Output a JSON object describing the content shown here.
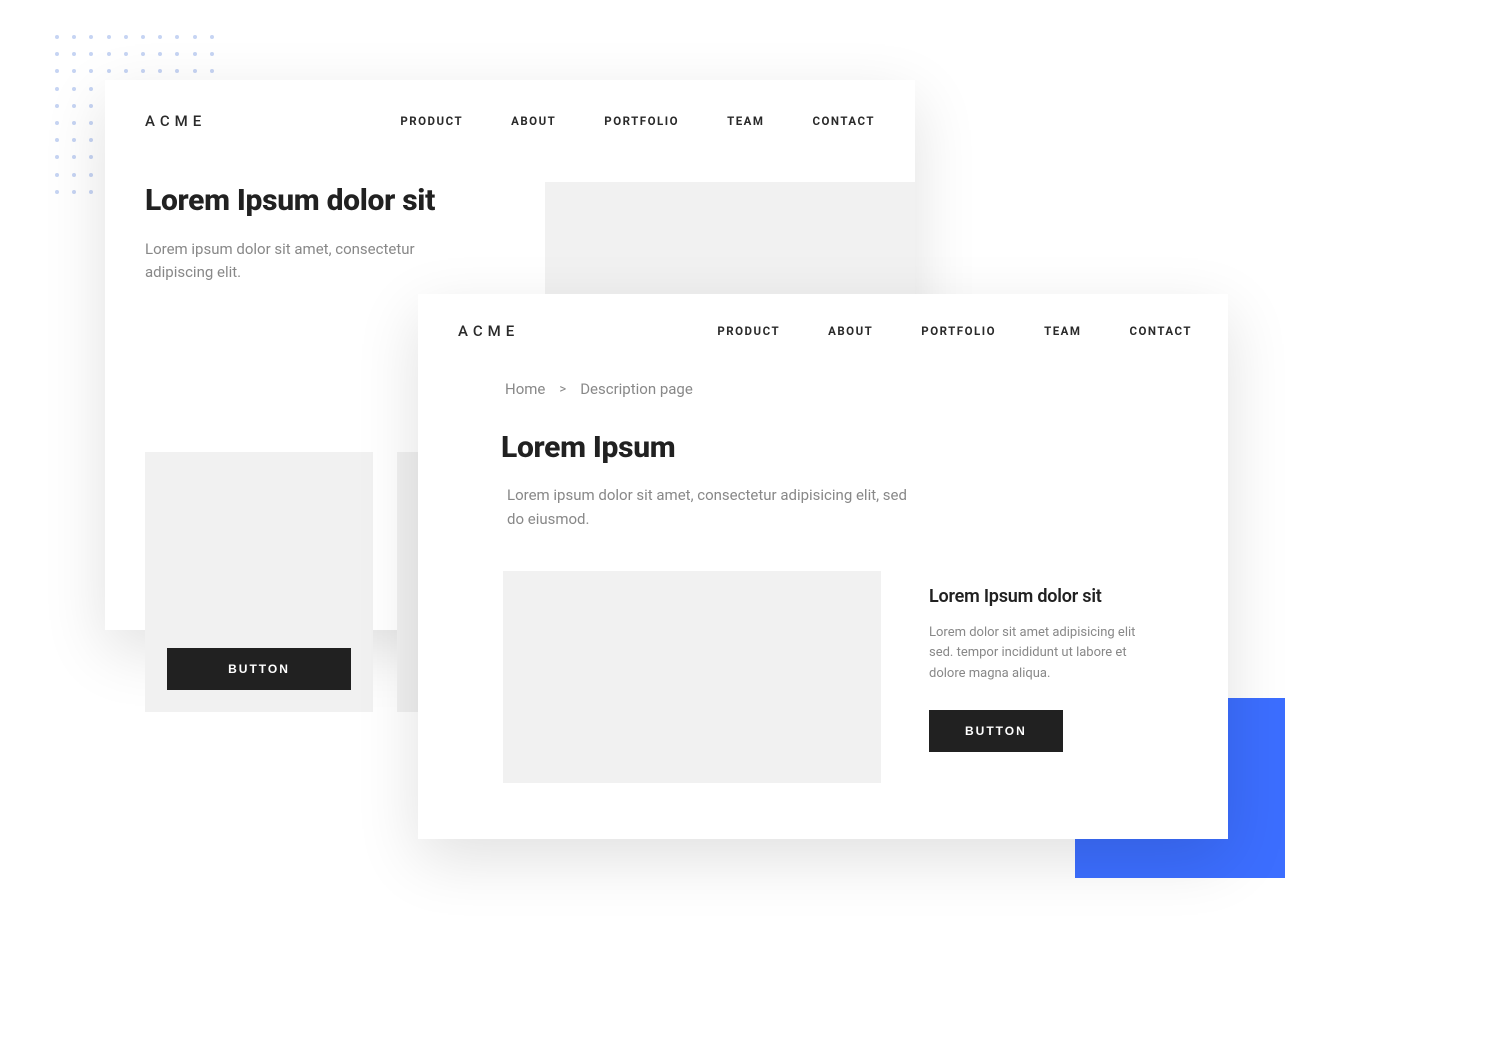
{
  "logo": "ACME",
  "nav": {
    "items": [
      "PRODUCT",
      "ABOUT",
      "PORTFOLIO",
      "TEAM",
      "CONTACT"
    ]
  },
  "card_back": {
    "hero_title": "Lorem Ipsum dolor sit",
    "hero_sub": "Lorem ipsum dolor sit amet, consectetur adipiscing elit.",
    "button_label": "BUTTON"
  },
  "card_front": {
    "breadcrumb": {
      "home": "Home",
      "sep": ">",
      "current": "Description page"
    },
    "title": "Lorem Ipsum",
    "sub": "Lorem ipsum dolor sit amet, consectetur adipisicing elit, sed do eiusmod.",
    "detail": {
      "title": "Lorem Ipsum dolor sit",
      "body": "Lorem dolor sit amet adipisicing elit sed. tempor incididunt ut labore et dolore magna aliqua.",
      "button_label": "BUTTON"
    }
  }
}
